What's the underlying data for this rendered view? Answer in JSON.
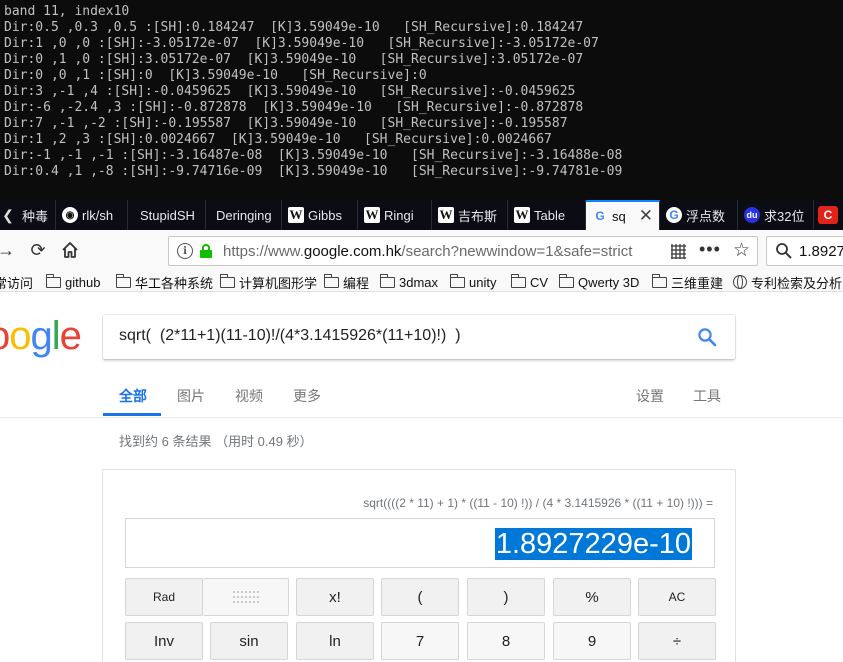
{
  "console": {
    "lines": [
      "band 11, index10",
      "Dir:0.5 ,0.3 ,0.5 :[SH]:0.184247  [K]3.59049e-10   [SH_Recursive]:0.184247",
      "Dir:1 ,0 ,0 :[SH]:-3.05172e-07  [K]3.59049e-10   [SH_Recursive]:-3.05172e-07",
      "Dir:0 ,1 ,0 :[SH]:3.05172e-07  [K]3.59049e-10   [SH_Recursive]:3.05172e-07",
      "Dir:0 ,0 ,1 :[SH]:0  [K]3.59049e-10   [SH_Recursive]:0",
      "Dir:3 ,-1 ,4 :[SH]:-0.0459625  [K]3.59049e-10   [SH_Recursive]:-0.0459625",
      "Dir:-6 ,-2.4 ,3 :[SH]:-0.872878  [K]3.59049e-10   [SH_Recursive]:-0.872878",
      "Dir:7 ,-1 ,-2 :[SH]:-0.195587  [K]3.59049e-10   [SH_Recursive]:-0.195587",
      "Dir:1 ,2 ,3 :[SH]:0.0024667  [K]3.59049e-10   [SH_Recursive]:0.0024667",
      "Dir:-1 ,-1 ,-1 :[SH]:-3.16487e-08  [K]3.59049e-10   [SH_Recursive]:-3.16488e-08",
      "Dir:0.4 ,1 ,-8 :[SH]:-9.74716e-09  [K]3.59049e-10   [SH_Recursive]:-9.74781e-09"
    ]
  },
  "browser": {
    "tabs": [
      {
        "label": "种毒",
        "icon": "none"
      },
      {
        "label": "rlk/sh",
        "icon": "github-icon"
      },
      {
        "label": "StupidSH",
        "icon": "none"
      },
      {
        "label": "Deringing",
        "icon": "none"
      },
      {
        "label": "Gibbs",
        "icon": "wikipedia-icon"
      },
      {
        "label": "Ringi",
        "icon": "wikipedia-icon"
      },
      {
        "label": "吉布斯",
        "icon": "wikipedia-icon"
      },
      {
        "label": "Table",
        "icon": "wikipedia-icon"
      },
      {
        "label": "sq",
        "icon": "google-icon"
      },
      {
        "label": "浮点数",
        "icon": "google-icon"
      },
      {
        "label": "求32位",
        "icon": "baidu-icon"
      }
    ],
    "active_tab_index": 8,
    "url_dim": "https://www.",
    "url_host": "google.com.hk",
    "url_rest": "/search?newwindow=1&safe=strict",
    "search_value": "1.8927",
    "bookmarks": [
      "常访问",
      "github",
      "华工各种系统",
      "计算机图形学",
      "编程",
      "3dmax",
      "unity",
      "CV",
      "Qwerty 3D",
      "三维重建",
      "专利检索及分析"
    ]
  },
  "google": {
    "logo_letters": [
      "o",
      "o",
      "g",
      "l",
      "e"
    ],
    "logo_colors": [
      "#ea4335",
      "#fbbc05",
      "#4285f4",
      "#34a853",
      "#ea4335"
    ],
    "query": "sqrt(  (2*11+1)(11-10)!/(4*3.1415926*(11+10)!)  )",
    "tabs": [
      "全部",
      "图片",
      "视频",
      "更多"
    ],
    "right_tabs": [
      "设置",
      "工具"
    ],
    "result_stats": "找到约 6 条结果  （用时 0.49 秒）",
    "accent": "#1a73e8"
  },
  "calculator": {
    "expression": "sqrt((((2 * 11) + 1) * ((11 - 10) !)) / (4 * 3.1415926 * ((11 + 10) !))) =",
    "result": "1.8927229e-10",
    "row1": [
      "Rad",
      "",
      "x!",
      "(",
      ")",
      "%",
      "AC"
    ],
    "row2": [
      "Inv",
      "sin",
      "ln",
      "7",
      "8",
      "9",
      "÷"
    ]
  }
}
